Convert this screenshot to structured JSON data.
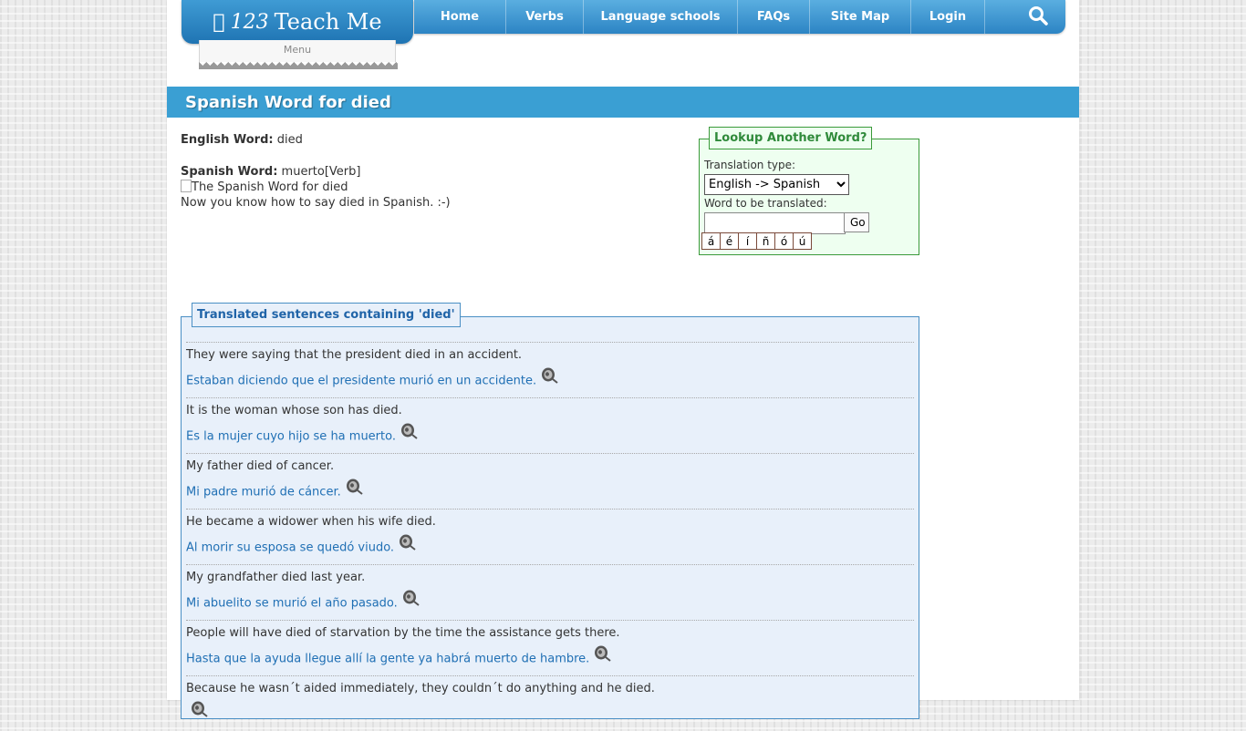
{
  "header": {
    "logo_num": "123",
    "logo_text": "Teach Me",
    "menu_label": "Menu",
    "nav": [
      "Home",
      "Verbs",
      "Language schools",
      "FAQs",
      "Site Map",
      "Login"
    ]
  },
  "page_title": "Spanish Word for died",
  "word": {
    "english_label": "English Word:",
    "english_value": "died",
    "spanish_label": "Spanish Word:",
    "spanish_value": "muerto[Verb]",
    "image_alt": "The Spanish Word for died",
    "note": "Now you know how to say died in Spanish. :-)"
  },
  "lookup": {
    "legend": "Lookup Another Word?",
    "type_label": "Translation type:",
    "type_selected": "English -> Spanish",
    "word_label": "Word to be translated:",
    "word_value": "",
    "go_label": "Go",
    "accents": [
      "á",
      "é",
      "í",
      "ñ",
      "ó",
      "ú"
    ]
  },
  "sentences": {
    "legend": "Translated sentences containing 'died'",
    "items": [
      {
        "en": "They were saying that the president died in an accident.",
        "es": "Estaban diciendo que el presidente murió en un accidente."
      },
      {
        "en": "It is the woman whose son has died.",
        "es": "Es la mujer cuyo hijo se ha muerto."
      },
      {
        "en": "My father died of cancer.",
        "es": "Mi padre murió de cáncer."
      },
      {
        "en": "He became a widower when his wife died.",
        "es": "Al morir su esposa se quedó viudo."
      },
      {
        "en": "My grandfather died last year.",
        "es": "Mi abuelito se murió el año pasado."
      },
      {
        "en": "People will have died of starvation by the time the assistance gets there.",
        "es": "Hasta que la ayuda llegue allí la gente ya habrá muerto de hambre."
      },
      {
        "en": "Because he wasn´t aided immediately, they couldn´t do anything and he died.",
        "es": ""
      }
    ]
  }
}
